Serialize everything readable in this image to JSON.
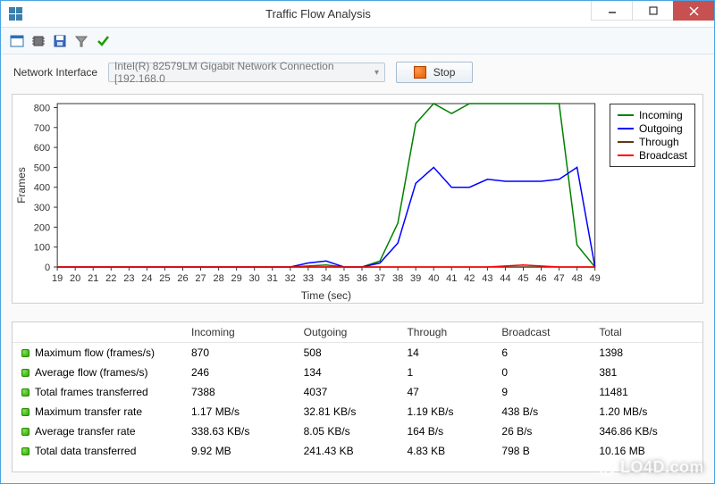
{
  "window": {
    "title": "Traffic Flow Analysis"
  },
  "toolbar": {
    "icons": [
      "panel-icon",
      "chip-icon",
      "save-icon",
      "filter-icon",
      "check-icon"
    ]
  },
  "interface": {
    "label": "Network Interface",
    "selected": "Intel(R) 82579LM Gigabit Network Connection [192.168.0",
    "stop_label": "Stop"
  },
  "chart_data": {
    "type": "line",
    "xlabel": "Time (sec)",
    "ylabel": "Frames",
    "xlim": [
      19,
      49
    ],
    "ylim": [
      0,
      820
    ],
    "x": [
      19,
      20,
      21,
      22,
      23,
      24,
      25,
      26,
      27,
      28,
      29,
      30,
      31,
      32,
      33,
      34,
      35,
      36,
      37,
      38,
      39,
      40,
      41,
      42,
      43,
      44,
      45,
      46,
      47,
      48,
      49
    ],
    "series": [
      {
        "name": "Incoming",
        "color": "#008000",
        "values": [
          0,
          0,
          0,
          0,
          0,
          0,
          0,
          0,
          0,
          0,
          0,
          0,
          0,
          0,
          5,
          10,
          0,
          0,
          30,
          220,
          720,
          820,
          770,
          820,
          820,
          820,
          820,
          820,
          820,
          110,
          0
        ]
      },
      {
        "name": "Outgoing",
        "color": "#0000ff",
        "values": [
          0,
          0,
          0,
          0,
          0,
          0,
          0,
          0,
          0,
          0,
          0,
          0,
          0,
          0,
          20,
          30,
          0,
          0,
          20,
          120,
          420,
          500,
          400,
          400,
          440,
          430,
          430,
          430,
          440,
          500,
          0
        ]
      },
      {
        "name": "Through",
        "color": "#5a3a1a",
        "values": [
          0,
          0,
          0,
          0,
          0,
          0,
          0,
          0,
          0,
          0,
          0,
          0,
          0,
          0,
          0,
          0,
          0,
          0,
          0,
          0,
          0,
          0,
          0,
          0,
          0,
          0,
          0,
          0,
          0,
          0,
          0
        ]
      },
      {
        "name": "Broadcast",
        "color": "#ff0000",
        "values": [
          0,
          0,
          0,
          0,
          0,
          0,
          0,
          0,
          0,
          0,
          0,
          0,
          0,
          0,
          0,
          0,
          0,
          0,
          0,
          0,
          0,
          0,
          0,
          0,
          0,
          5,
          10,
          5,
          0,
          0,
          0
        ]
      }
    ],
    "yticks": [
      0,
      100,
      200,
      300,
      400,
      500,
      600,
      700,
      800
    ],
    "xticks": [
      19,
      20,
      21,
      22,
      23,
      24,
      25,
      26,
      27,
      28,
      29,
      30,
      31,
      32,
      33,
      34,
      35,
      36,
      37,
      38,
      39,
      40,
      41,
      42,
      43,
      44,
      45,
      46,
      47,
      48,
      49
    ]
  },
  "stats": {
    "columns": [
      "",
      "Incoming",
      "Outgoing",
      "Through",
      "Broadcast",
      "Total"
    ],
    "rows": [
      {
        "metric": "Maximum flow (frames/s)",
        "cells": [
          "870",
          "508",
          "14",
          "6",
          "1398"
        ]
      },
      {
        "metric": "Average flow (frames/s)",
        "cells": [
          "246",
          "134",
          "1",
          "0",
          "381"
        ]
      },
      {
        "metric": "Total frames transferred",
        "cells": [
          "7388",
          "4037",
          "47",
          "9",
          "11481"
        ]
      },
      {
        "metric": "Maximum transfer rate",
        "cells": [
          "1.17 MB/s",
          "32.81 KB/s",
          "1.19 KB/s",
          "438 B/s",
          "1.20 MB/s"
        ]
      },
      {
        "metric": "Average transfer rate",
        "cells": [
          "338.63 KB/s",
          "8.05 KB/s",
          "164 B/s",
          "26 B/s",
          "346.86 KB/s"
        ]
      },
      {
        "metric": "Total data transferred",
        "cells": [
          "9.92 MB",
          "241.43 KB",
          "4.83 KB",
          "798 B",
          "10.16 MB"
        ]
      }
    ]
  },
  "watermark": "LO4D.com"
}
